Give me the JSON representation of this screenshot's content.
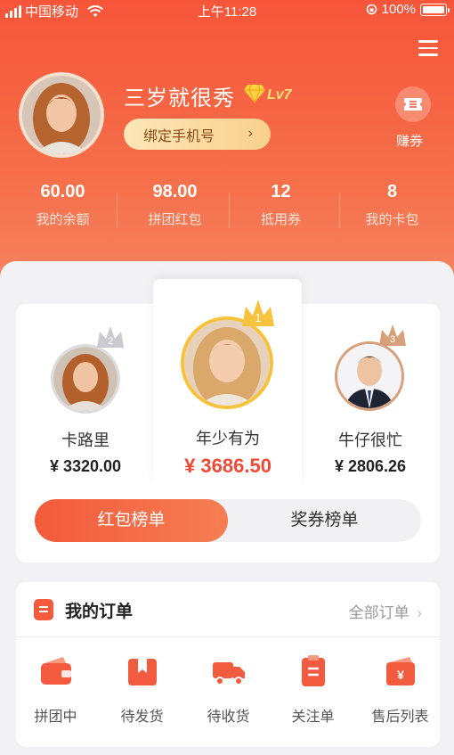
{
  "status_bar": {
    "carrier": "中国移动",
    "time": "上午11:28",
    "battery": "100%"
  },
  "profile": {
    "username": "三岁就很秀",
    "level": "Lv7",
    "bind_phone_label": "绑定手机号",
    "coupon_label": "赚券"
  },
  "stats": [
    {
      "value": "60.00",
      "label": "我的余额"
    },
    {
      "value": "98.00",
      "label": "拼团红包"
    },
    {
      "value": "12",
      "label": "抵用券"
    },
    {
      "value": "8",
      "label": "我的卡包"
    }
  ],
  "ranking": {
    "first": {
      "rank": "1",
      "name": "年少有为",
      "amount": "¥ 3686.50"
    },
    "second": {
      "rank": "2",
      "name": "卡路里",
      "amount": "¥ 3320.00"
    },
    "third": {
      "rank": "3",
      "name": "牛仔很忙",
      "amount": "¥ 2806.26"
    },
    "tabs": {
      "active": "红包榜单",
      "inactive": "奖券榜单"
    }
  },
  "orders": {
    "title": "我的订单",
    "all_label": "全部订单",
    "items": [
      {
        "label": "拼团中",
        "icon": "wallet-icon"
      },
      {
        "label": "待发货",
        "icon": "gift-box-icon"
      },
      {
        "label": "待收货",
        "icon": "truck-icon"
      },
      {
        "label": "关注单",
        "icon": "clipboard-icon"
      },
      {
        "label": "售后列表",
        "icon": "yen-card-icon"
      }
    ]
  },
  "colors": {
    "accent": "#f35a3c",
    "gold": "#f7c33c",
    "silver": "#c9c9cf",
    "bronze": "#d7a07a"
  }
}
